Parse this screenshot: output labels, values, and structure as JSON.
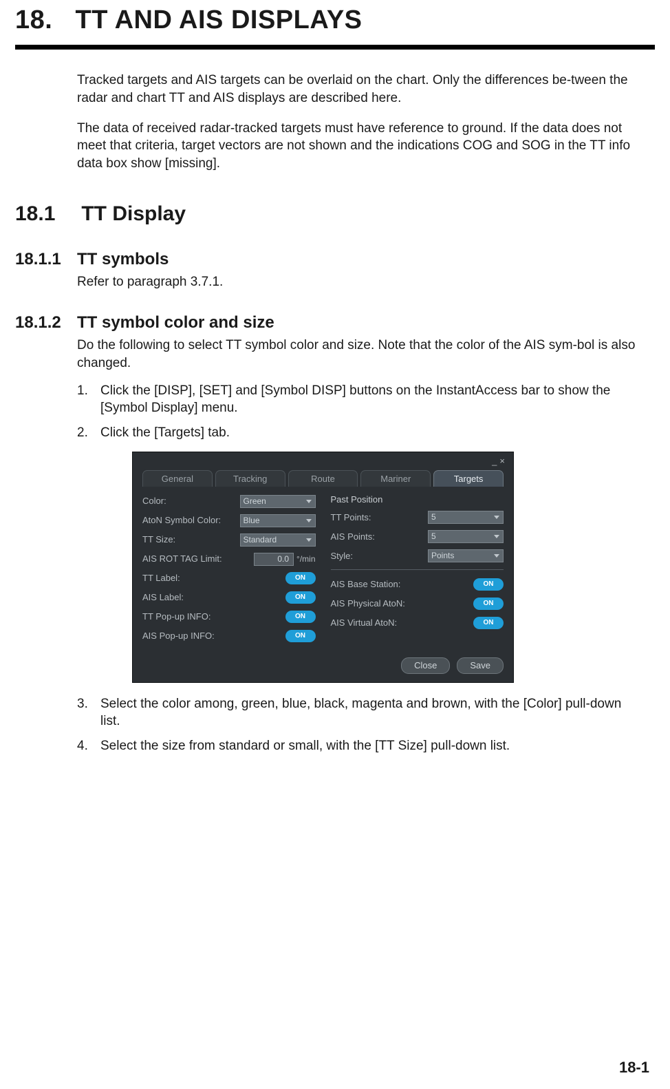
{
  "chapter": {
    "number": "18.",
    "title": "TT AND AIS DISPLAYS"
  },
  "intro": {
    "p1": "Tracked targets and AIS targets can be overlaid on the chart. Only the differences be-tween the radar and chart TT and AIS displays are described here.",
    "p2": "The data of received radar-tracked targets must have reference to ground. If the data does not meet that criteria, target vectors are not shown and the indications COG and SOG in the TT info data box show [missing]."
  },
  "s1": {
    "num": "18.1",
    "title": "TT Display"
  },
  "s11": {
    "num": "18.1.1",
    "title": "TT symbols",
    "body": "Refer to paragraph 3.7.1."
  },
  "s12": {
    "num": "18.1.2",
    "title": "TT symbol color and size",
    "body": "Do the following to select TT symbol color and size. Note that the color of the AIS sym-bol is also changed.",
    "steps": {
      "1": "Click the [DISP], [SET] and [Symbol DISP] buttons on the InstantAccess bar to show the [Symbol Display] menu.",
      "2": "Click the [Targets] tab.",
      "3": "Select the color among, green, blue, black, magenta and brown, with the [Color] pull-down list.",
      "4": "Select the size from standard or small, with the [TT Size] pull-down list."
    }
  },
  "dialog": {
    "win_min": "_",
    "win_close": "×",
    "tabs": {
      "general": "General",
      "tracking": "Tracking",
      "route": "Route",
      "mariner": "Mariner",
      "targets": "Targets"
    },
    "left": {
      "color_lbl": "Color:",
      "color_val": "Green",
      "aton_lbl": "AtoN Symbol Color:",
      "aton_val": "Blue",
      "ttsize_lbl": "TT Size:",
      "ttsize_val": "Standard",
      "rot_lbl": "AIS ROT TAG Limit:",
      "rot_val": "0.0",
      "rot_unit": "°/min",
      "ttlabel_lbl": "TT Label:",
      "aislabel_lbl": "AIS Label:",
      "ttpopup_lbl": "TT Pop-up INFO:",
      "aispopup_lbl": "AIS Pop-up INFO:"
    },
    "right": {
      "pastpos": "Past Position",
      "ttpoints_lbl": "TT Points:",
      "ttpoints_val": "5",
      "aispoints_lbl": "AIS Points:",
      "aispoints_val": "5",
      "style_lbl": "Style:",
      "style_val": "Points",
      "base_lbl": "AIS Base Station:",
      "phys_lbl": "AIS Physical AtoN:",
      "virt_lbl": "AIS Virtual AtoN:"
    },
    "toggle_on": "ON",
    "buttons": {
      "close": "Close",
      "save": "Save"
    }
  },
  "page_number": "18-1"
}
